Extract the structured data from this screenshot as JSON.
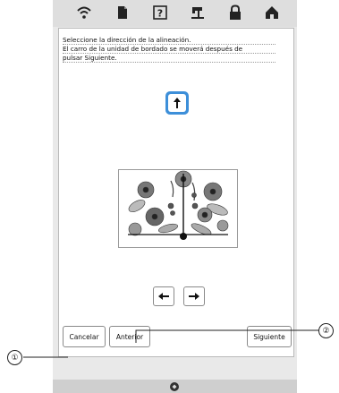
{
  "instructions": {
    "line1": "Seleccione la dirección de la alineación.",
    "line2": "El carro de la unidad de bordado se moverá después de",
    "line3": "pulsar Siguiente."
  },
  "buttons": {
    "cancel": "Cancelar",
    "previous": "Anterior",
    "next": "Siguiente"
  },
  "callouts": {
    "one": "①",
    "two": "②"
  },
  "colors": {
    "selected_button": "#3d8fd9"
  },
  "icons": [
    "wifi-icon",
    "document-icon",
    "help-icon",
    "sewing-machine-icon",
    "lock-icon",
    "home-icon",
    "up-arrow-icon",
    "left-arrow-icon",
    "right-arrow-icon"
  ]
}
